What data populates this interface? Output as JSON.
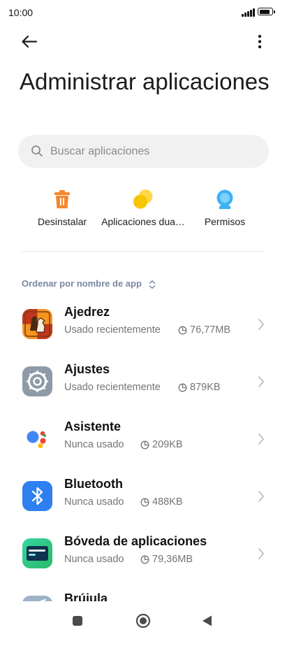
{
  "status_bar": {
    "time": "10:00",
    "battery_level": 0.9
  },
  "header": {
    "title": "Administrar aplicaciones"
  },
  "search": {
    "placeholder": "Buscar aplicaciones"
  },
  "quick_actions": [
    {
      "label": "Desinstalar",
      "icon": "trash-icon",
      "color": "#f5862b"
    },
    {
      "label": "Aplicaciones dua…",
      "icon": "dual-apps-icon",
      "color": "#f7c600"
    },
    {
      "label": "Permisos",
      "icon": "permissions-icon",
      "color": "#3cb2f3"
    }
  ],
  "sort": {
    "label": "Ordenar por nombre de app"
  },
  "apps": [
    {
      "name": "Ajedrez",
      "status": "Usado recientemente",
      "size": "76,77MB",
      "icon": "chess-icon"
    },
    {
      "name": "Ajustes",
      "status": "Usado recientemente",
      "size": "879KB",
      "icon": "settings-gear-icon"
    },
    {
      "name": "Asistente",
      "status": "Nunca usado",
      "size": "209KB",
      "icon": "assistant-icon"
    },
    {
      "name": "Bluetooth",
      "status": "Nunca usado",
      "size": "488KB",
      "icon": "bluetooth-icon"
    },
    {
      "name": "Bóveda de aplicaciones",
      "status": "Nunca usado",
      "size": "79,36MB",
      "icon": "app-vault-icon"
    },
    {
      "name": "Brújula",
      "icon": "compass-icon"
    }
  ],
  "colors": {
    "accent_text": "#7b87a1",
    "secondary_text": "#747474",
    "search_bg": "#f1f1f1"
  }
}
